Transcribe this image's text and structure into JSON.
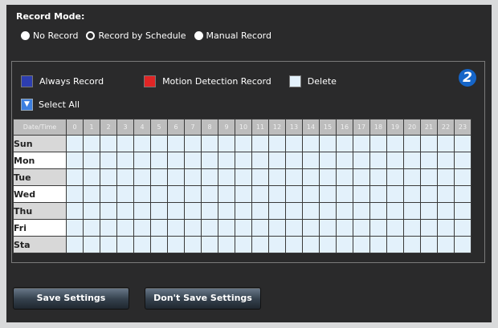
{
  "record_mode": {
    "title": "Record Mode:",
    "options": [
      {
        "label": "No Record",
        "selected": false
      },
      {
        "label": "Record by Schedule",
        "selected": true
      },
      {
        "label": "Manual Record",
        "selected": false
      }
    ]
  },
  "legend": {
    "always_record": {
      "label": "Always Record",
      "color": "#2d3eb0"
    },
    "motion_detection": {
      "label": "Motion Detection Record",
      "color": "#e02525"
    },
    "delete": {
      "label": "Delete",
      "color": "#e3f1fb"
    }
  },
  "badge": "2",
  "select_all": {
    "label": "Select All"
  },
  "schedule": {
    "corner_label": "Date/Time",
    "hours": [
      "0",
      "1",
      "2",
      "3",
      "4",
      "5",
      "6",
      "7",
      "8",
      "9",
      "10",
      "11",
      "12",
      "13",
      "14",
      "15",
      "16",
      "17",
      "18",
      "19",
      "20",
      "21",
      "22",
      "23"
    ],
    "days": [
      "Sun",
      "Mon",
      "Tue",
      "Wed",
      "Thu",
      "Fri",
      "Sta"
    ]
  },
  "buttons": {
    "save": "Save Settings",
    "dont_save": "Don't Save Settings"
  }
}
